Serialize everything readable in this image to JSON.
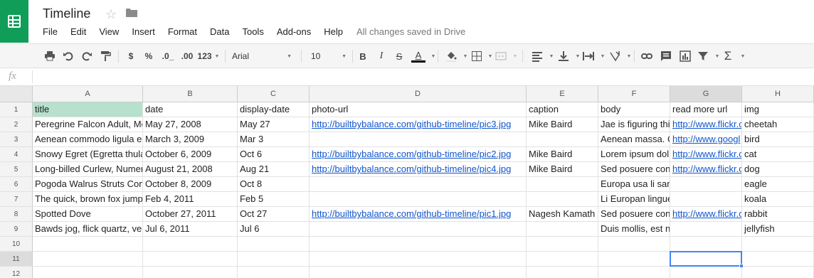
{
  "doc": {
    "title": "Timeline",
    "save_status": "All changes saved in Drive"
  },
  "menu": [
    "File",
    "Edit",
    "View",
    "Insert",
    "Format",
    "Data",
    "Tools",
    "Add-ons",
    "Help"
  ],
  "toolbar": {
    "currency": "$",
    "percent": "%",
    "dec_less": ".0_",
    "dec_more": ".00",
    "more_formats": "123",
    "font": "Arial",
    "font_size": "10",
    "bold": "B",
    "italic": "I",
    "strike": "S",
    "text_color": "A",
    "sigma": "Σ"
  },
  "formula": {
    "fx": "fx"
  },
  "columns": [
    "A",
    "B",
    "C",
    "D",
    "E",
    "F",
    "G",
    "H"
  ],
  "row_numbers": [
    "1",
    "2",
    "3",
    "4",
    "5",
    "6",
    "7",
    "8",
    "9",
    "10",
    "11",
    "12"
  ],
  "rows": [
    [
      "title",
      "date",
      "display-date",
      "photo-url",
      "caption",
      "body",
      "read more url",
      "img"
    ],
    [
      "Peregrine Falcon Adult, Mo",
      "May 27, 2008",
      "May 27",
      "http://builtbybalance.com/github-timeline/pic3.jpg",
      "Mike Baird",
      "Jae is figuring thi",
      "http://www.flickr.c",
      "cheetah"
    ],
    [
      "Aenean commodo ligula eg",
      "March 3, 2009",
      "Mar 3",
      "",
      "",
      "Aenean massa. C",
      "http://www.googl",
      "bird"
    ],
    [
      "Snowy Egret (Egretta thula",
      "October 6, 2009",
      "Oct 6",
      "http://builtbybalance.com/github-timeline/pic2.jpg",
      "Mike Baird",
      "Lorem ipsum dol",
      "http://www.flickr.c",
      "cat"
    ],
    [
      "Long-billed Curlew, Numer",
      "August 21, 2008",
      "Aug 21",
      "http://builtbybalance.com/github-timeline/pic4.jpg",
      "Mike Baird",
      "Sed posuere con",
      "http://www.flickr.c",
      "dog"
    ],
    [
      "Pogoda Walrus Struts Con",
      "October 8, 2009",
      "Oct 8",
      "",
      "",
      "Europa usa li sam vocabular. Li lin",
      "",
      "eagle"
    ],
    [
      "The quick, brown fox jump",
      "Feb 4, 2011",
      "Feb 5",
      "",
      "",
      "Li Europan lingues es membres de",
      "",
      "koala"
    ],
    [
      "Spotted Dove",
      "October 27, 2011",
      "Oct 27",
      "http://builtbybalance.com/github-timeline/pic1.jpg",
      "Nagesh Kamath",
      "Sed posuere con",
      "http://www.flickr.c",
      "rabbit"
    ],
    [
      "Bawds jog, flick quartz, ve:",
      "Jul 6, 2011",
      "Jul 6",
      "",
      "",
      "Duis mollis, est non commodo luct",
      "",
      "jellyfish"
    ],
    [
      "",
      "",
      "",
      "",
      "",
      "",
      "",
      ""
    ],
    [
      "",
      "",
      "",
      "",
      "",
      "",
      "",
      ""
    ],
    [
      "",
      "",
      "",
      "",
      "",
      "",
      "",
      ""
    ]
  ],
  "colors": {
    "brand": "#0f9d58",
    "link": "#1155cc",
    "header_highlight": "#b7e1cd",
    "selection": "#4285f4"
  }
}
